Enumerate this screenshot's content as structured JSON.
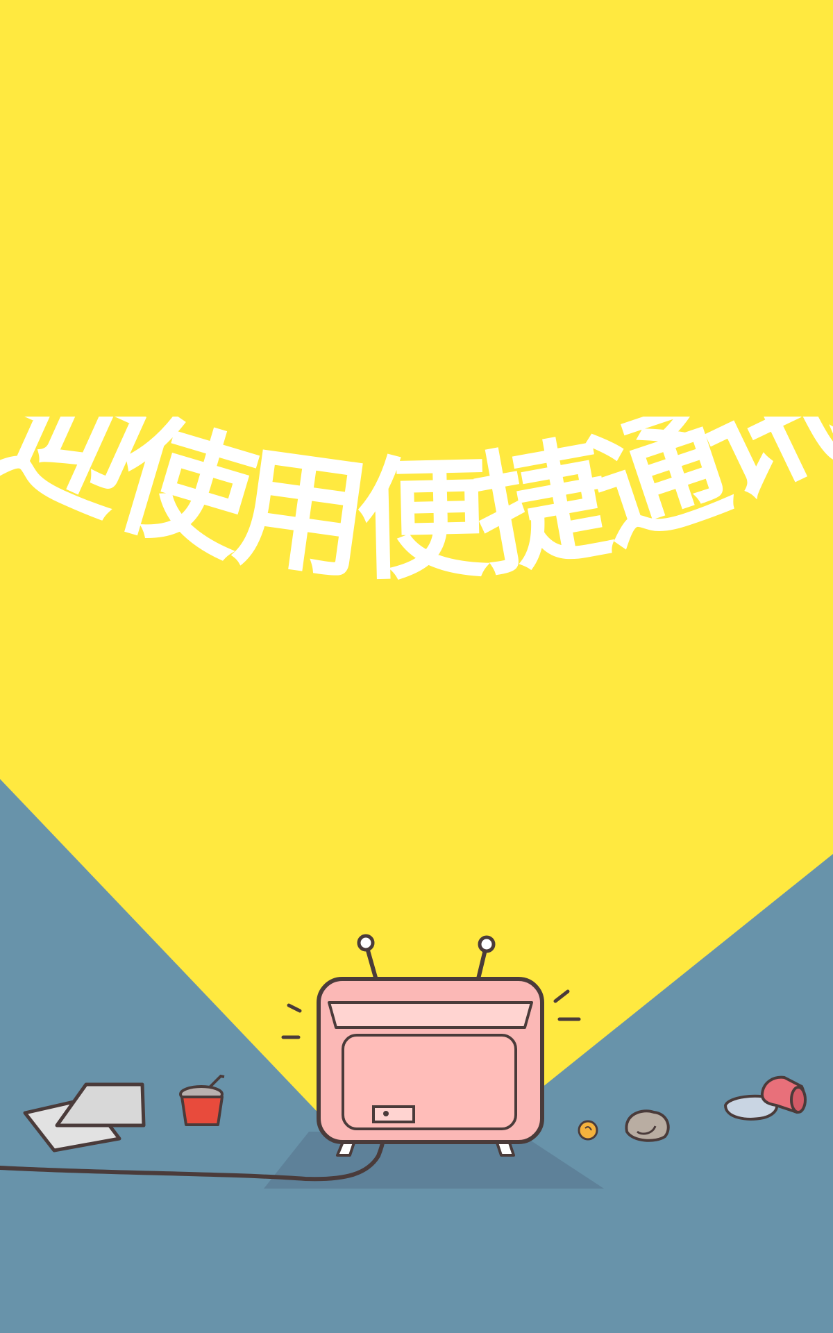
{
  "splash": {
    "welcome_text": "欢迎使用便捷通讯录"
  },
  "colors": {
    "background_yellow": "#FFE940",
    "floor_blue": "#6893AA",
    "tv_pink": "#FBB8B6",
    "tv_pink_light": "#FFD4D1",
    "outline": "#4A3B3A",
    "cup_red": "#E84B3C",
    "title_white": "#FFFFFF"
  },
  "illustration": {
    "main": "tv-icon",
    "props": [
      "papers-icon",
      "drink-cup-icon",
      "coin-icon",
      "rock-icon",
      "spilled-cup-icon",
      "power-cable-icon"
    ]
  }
}
